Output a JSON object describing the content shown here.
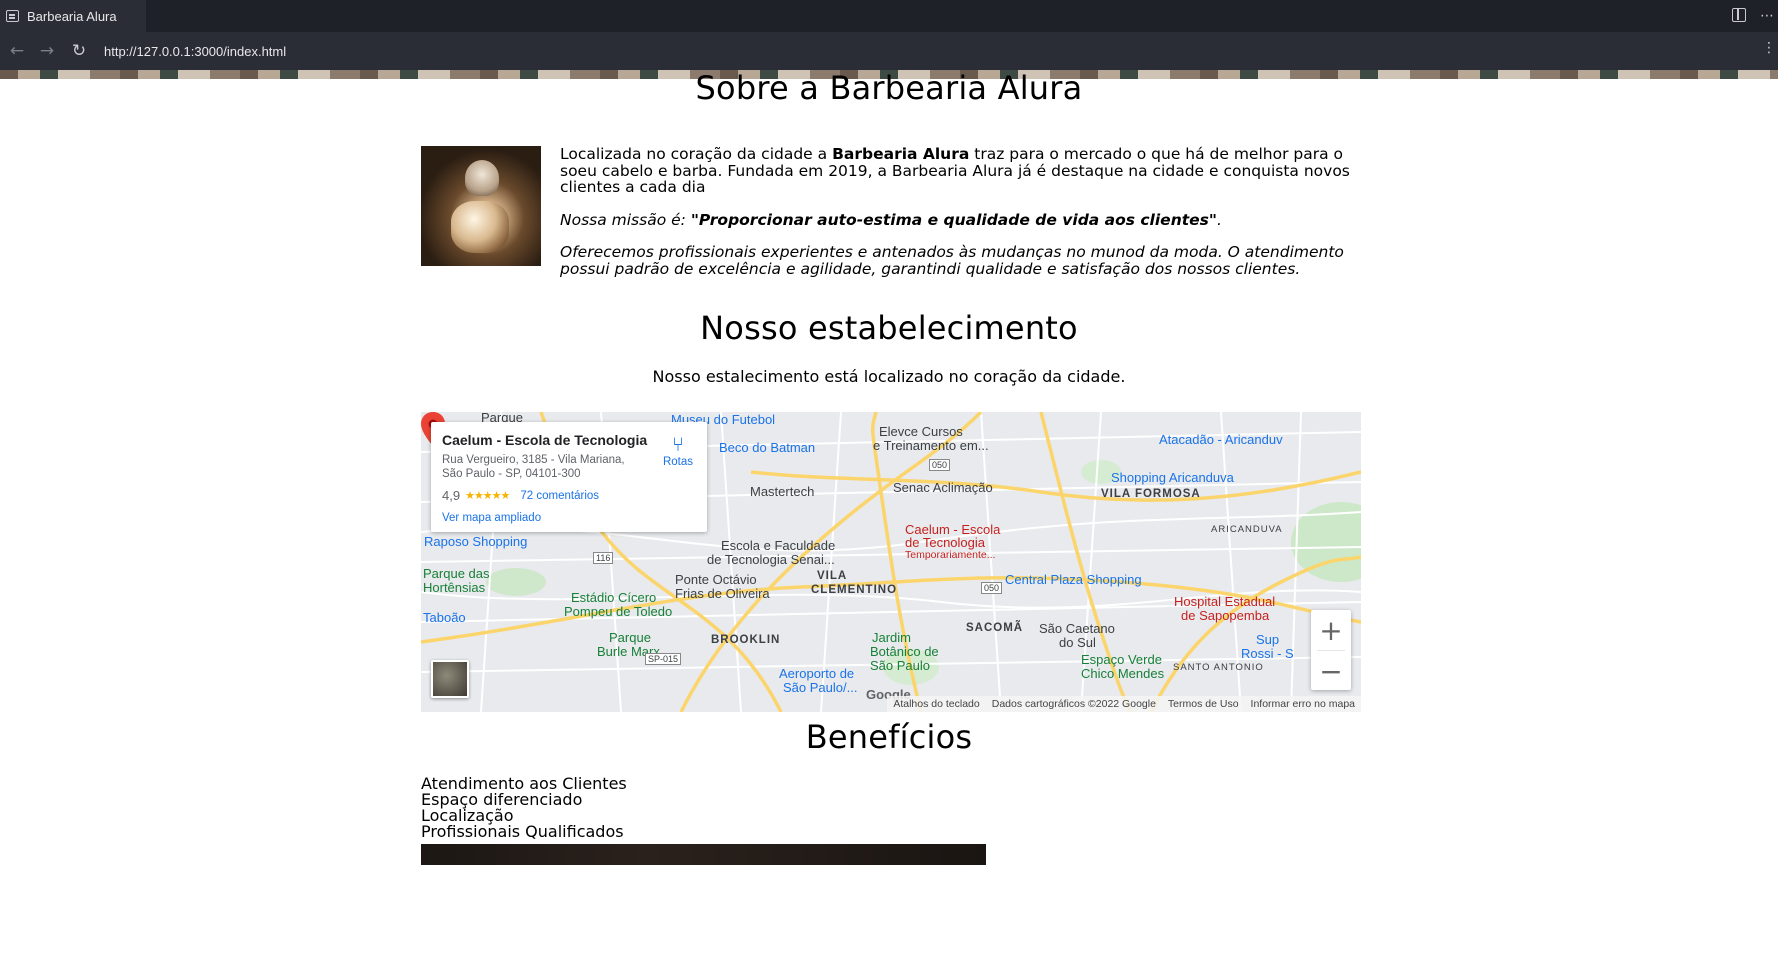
{
  "browser": {
    "tab_title": "Barbearia Alura",
    "url": "http://127.0.0.1:3000/index.html",
    "icons": [
      "tab-page-icon",
      "sidebar-toggle-icon",
      "more-icon",
      "back-arrow-icon",
      "forward-arrow-icon",
      "reload-icon",
      "menu-icon"
    ]
  },
  "about": {
    "title": "Sobre a Barbearia Alura",
    "p1_before": "Localizada no coração da cidade a ",
    "p1_brand": "Barbearia Alura",
    "p1_after": " traz para o mercado o que há de melhor para o soeu cabelo e barba. Fundada em 2019, a Barbearia Alura já é destaque na cidade e conquista novos clientes a cada dia",
    "mission_label": "Nossa missão é: ",
    "mission_quote": "\"Proporcionar auto-estima e qualidade de vida aos clientes\"",
    "mission_end": ".",
    "p3": "Oferecemos profissionais experientes e antenados às mudanças no munod da moda. O atendimento possui padrão de excelência e agilidade, garantindi qualidade e satisfação dos nossos clientes."
  },
  "establishment": {
    "title": "Nosso estabelecimento",
    "subtitle": "Nosso estalecimento está localizado no coração da cidade."
  },
  "map": {
    "place_name": "Caelum - Escola de Tecnologia",
    "address_line1": "Rua Vergueiro, 3185 - Vila Mariana,",
    "address_line2": "São Paulo - SP, 04101-300",
    "rating": "4,9",
    "stars": "★★★★★",
    "reviews": "72 comentários",
    "bigger_map": "Ver mapa ampliado",
    "directions": "Rotas",
    "labels": {
      "parque": "Parque",
      "museu": "Museu do Futebol",
      "beco": "Beco do Batman",
      "elevce1": "Elevce Cursos",
      "elevce2": "e Treinamento em...",
      "atacadao": "Atacadão - Aricanduv",
      "shopping_aric": "Shopping Aricanduva",
      "mastertech": "Mastertech",
      "senac": "Senac Aclimação",
      "vila_formosa": "VILA FORMOSA",
      "aricanduva": "ARICANDUVA",
      "raposo": "Raposo Shopping",
      "escola1": "Escola e Faculdade",
      "escola2": "de Tecnologia Senai...",
      "caelum1": "Caelum - Escola",
      "caelum2": "de Tecnologia",
      "caelum3": "Temporariamente...",
      "central_plaza": "Central Plaza Shopping",
      "parque_hort1": "Parque das",
      "parque_hort2": "Hortênsias",
      "ponte1": "Ponte Octávio",
      "ponte2": "Frias de Oliveira",
      "vila_clem1": "VILA",
      "vila_clem2": "CLEMENTINO",
      "estadio1": "Estádio Cícero",
      "estadio2": "Pompeu de Toledo",
      "hospital1": "Hospital Estadual",
      "hospital2": "de Sapopemba",
      "taboao": "Taboão",
      "burle1": "Parque",
      "burle2": "Burle Marx",
      "brooklin": "BROOKLIN",
      "sacoma": "SACOMÃ",
      "sao_caetano1": "São Caetano",
      "sao_caetano2": "do Sul",
      "jardim1": "Jardim",
      "jardim2": "Botânico de",
      "jardim3": "São Paulo",
      "aeroporto1": "Aeroporto de",
      "aeroporto2": "São Paulo/...",
      "espaco1": "Espaço Verde",
      "espaco2": "Chico Mendes",
      "santo_antonio": "SANTO ANTONIO",
      "sup_rossi1": "Sup",
      "sup_rossi2": "Rossi - S",
      "route_050a": "050",
      "route_050b": "050",
      "route_116": "116",
      "route_sp015": "SP-015"
    },
    "footer": {
      "shortcuts": "Atalhos do teclado",
      "data": "Dados cartográficos ©2022 Google",
      "terms": "Termos de Uso",
      "report": "Informar erro no mapa"
    },
    "google": "Google"
  },
  "benefits": {
    "title": "Benefícios",
    "items": [
      "Atendimento aos Clientes",
      "Espaço diferenciado",
      "Localização",
      "Profissionais Qualificados"
    ]
  }
}
